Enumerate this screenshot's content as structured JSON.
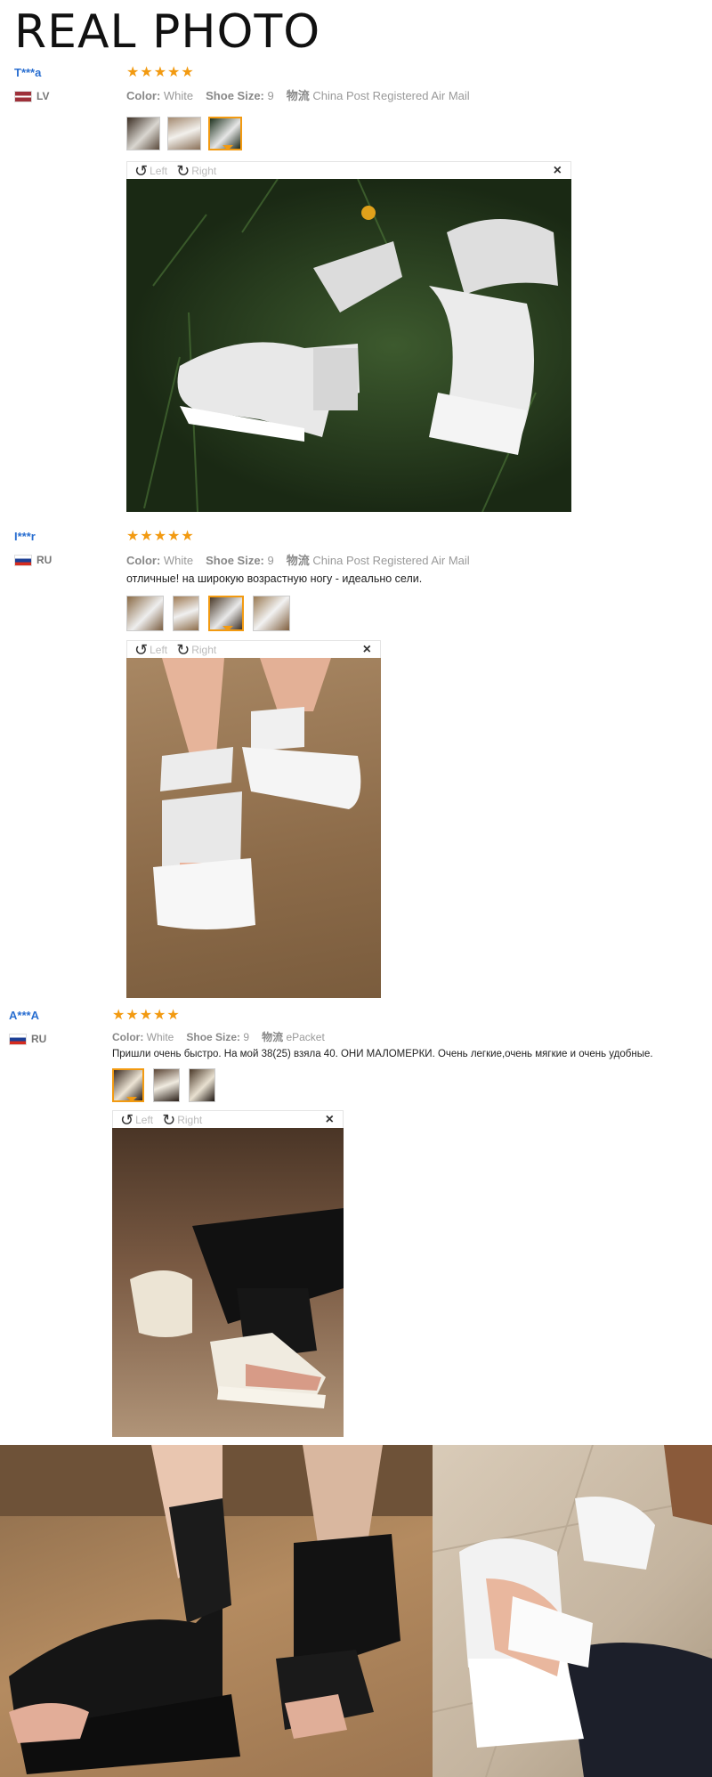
{
  "page": {
    "title": "REAL PHOTO"
  },
  "labels": {
    "color": "Color:",
    "shoe_size": "Shoe Size:",
    "logistics": "物流"
  },
  "toolbar": {
    "left": "Left",
    "right": "Right",
    "close": "×"
  },
  "reviews": [
    {
      "name": "T***a",
      "country": "LV",
      "stars": 5,
      "color": "White",
      "size": "9",
      "shipping": "China Post Registered Air Mail",
      "comment": "",
      "thumbs": 3,
      "active_thumb": 3
    },
    {
      "name": "I***r",
      "country": "RU",
      "stars": 5,
      "color": "White",
      "size": "9",
      "shipping": "China Post Registered Air Mail",
      "comment": "отличные! на широкую возрастную ногу - идеально сели.",
      "thumbs": 4,
      "active_thumb": 3
    },
    {
      "name": "A***A",
      "country": "RU",
      "stars": 5,
      "color": "White",
      "size": "9",
      "shipping": "ePacket",
      "comment": "Пришли очень быстро. На мой 38(25) взяла 40. ОНИ МАЛОМЕРКИ. Очень легкие,очень мягкие и очень удобные.",
      "thumbs": 3,
      "active_thumb": 1
    }
  ],
  "colors": {
    "star": "#f29a11",
    "name": "#2a6fd1",
    "accent": "#f29a11"
  }
}
